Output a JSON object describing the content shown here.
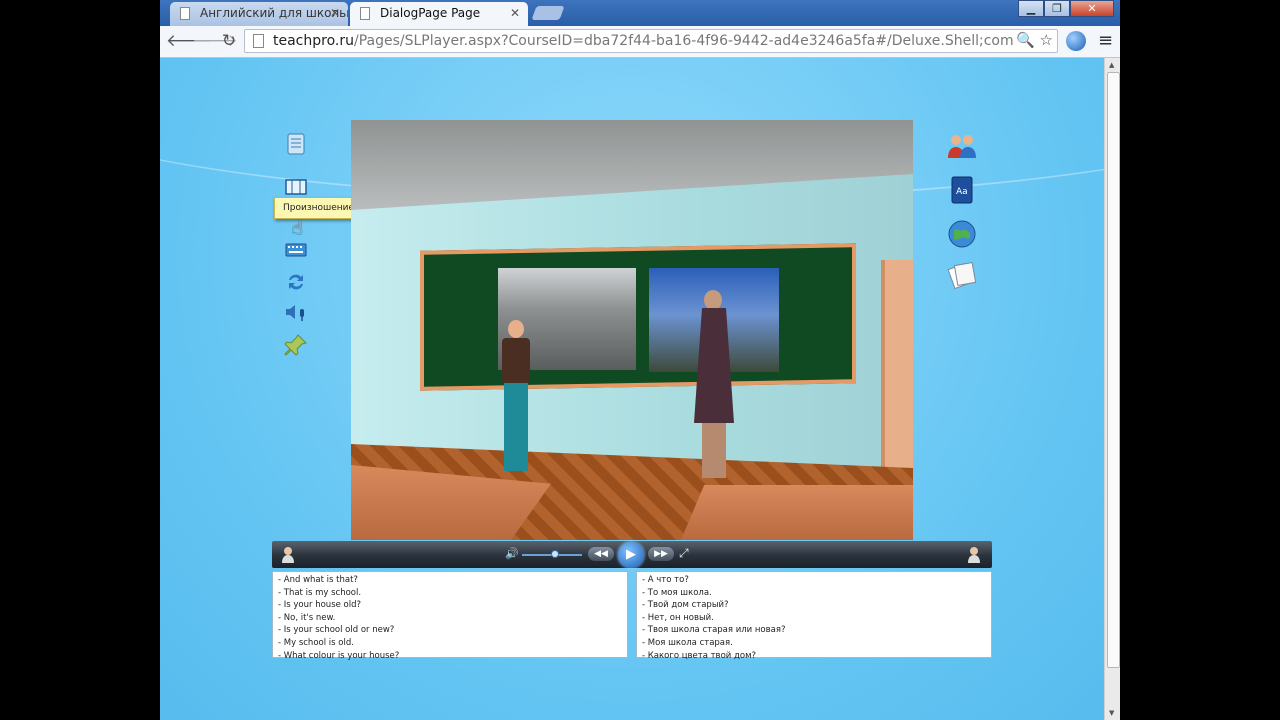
{
  "browser": {
    "tabs": [
      {
        "title": "Английский для школьн",
        "active": false
      },
      {
        "title": "DialogPage Page",
        "active": true
      }
    ],
    "url_host": "teachpro.ru",
    "url_rest": "/Pages/SLPlayer.aspx?CourseID=dba72f44-ba16-4f96-9442-ad4e3246a5fa#/Deluxe.Shell;component/Pages/"
  },
  "left_toolbar": {
    "items": [
      {
        "name": "text-list-icon"
      },
      {
        "name": "filmstrip-icon"
      },
      {
        "name": "pronunciation-icon",
        "tooltip": "Произношение"
      },
      {
        "name": "keyboard-icon"
      },
      {
        "name": "refresh-icon"
      },
      {
        "name": "speaker-mic-icon"
      },
      {
        "name": "pushpin-icon"
      }
    ]
  },
  "right_toolbar": {
    "items": [
      "people-icon",
      "dictionary-icon",
      "globe-icon",
      "notes-icon"
    ]
  },
  "player": {
    "play_symbol": "▶",
    "rewind_symbol": "◀◀",
    "forward_symbol": "▶▶",
    "fullscreen_symbol": "⤢",
    "volume_symbol": "🔊"
  },
  "transcript_en": [
    "- And what is that?",
    "- That is my school.",
    "- Is your house old?",
    "- No, it's new.",
    "- Is your school old or new?",
    "- My school is old.",
    "- What colour is your house?"
  ],
  "transcript_ru": [
    "- А что то?",
    "- То моя школа.",
    "- Твой дом старый?",
    "- Нет, он новый.",
    "- Твоя школа старая или новая?",
    "- Моя школа старая.",
    "- Какого цвета твой дом?"
  ]
}
